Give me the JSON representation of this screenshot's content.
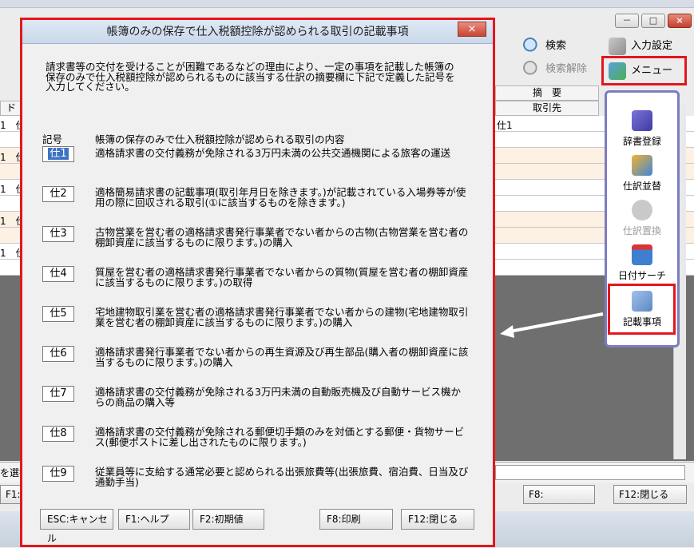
{
  "dialog": {
    "title": "帳簿のみの保存で仕入税額控除が認められる取引の記載事項",
    "close_label": "×",
    "intro": "請求書等の交付を受けることが困難であるなどの理由により、一定の事項を記載した帳簿の保存のみで仕入税額控除が認められるものに該当する仕訳の摘要欄に下記で定義した記号を入力してください。",
    "col_code": "記号",
    "col_content": "帳簿の保存のみで仕入税額控除が認められる取引の内容",
    "items": [
      {
        "code": "仕1",
        "text": "適格請求書の交付義務が免除される3万円未満の公共交通機関による旅客の運送"
      },
      {
        "code": "仕2",
        "text": "適格簡易請求書の記載事項(取引年月日を除きます。)が記載されている入場券等が使用の際に回収される取引(①に該当するものを除きます。)"
      },
      {
        "code": "仕3",
        "text": "古物営業を営む者の適格請求書発行事業者でない者からの古物(古物営業を営む者の棚卸資産に該当するものに限ります。)の購入"
      },
      {
        "code": "仕4",
        "text": "質屋を営む者の適格請求書発行事業者でない者からの質物(質屋を営む者の棚卸資産に該当するものに限ります。)の取得"
      },
      {
        "code": "仕5",
        "text": "宅地建物取引業を営む者の適格請求書発行事業者でない者からの建物(宅地建物取引業を営む者の棚卸資産に該当するものに限ります。)の購入"
      },
      {
        "code": "仕6",
        "text": "適格請求書発行事業者でない者からの再生資源及び再生部品(購入者の棚卸資産に該当するものに限ります。)の購入"
      },
      {
        "code": "仕7",
        "text": "適格請求書の交付義務が免除される3万円未満の自動販売機及び自動サービス機からの商品の購入等"
      },
      {
        "code": "仕8",
        "text": "適格請求書の交付義務が免除される郵便切手類のみを対価とする郵便・貨物サービス(郵便ポストに差し出されたものに限ります。)"
      },
      {
        "code": "仕9",
        "text": "従業員等に支給する通常必要と認められる出張旅費等(出張旅費、宿泊費、日当及び通勤手当)"
      }
    ],
    "buttons": {
      "esc": "ESC:キャンセル",
      "f1": "F1:ヘルプ",
      "f2": "F2:初期値",
      "f8": "F8:印刷",
      "f12": "F12:閉じる"
    }
  },
  "toolbar": {
    "search": "検索",
    "search_clear": "検索解除",
    "input_settings": "入力設定",
    "menu": "メニュー"
  },
  "window_controls": {
    "minimize": "－",
    "maximize": "□",
    "close": "×"
  },
  "grid": {
    "header_summary": "摘　要",
    "header_partner": "取引先",
    "left_header": "ド",
    "cell_summary_first": "仕1",
    "left_cells": [
      "1　仕",
      "1　仕",
      "1　仕",
      "1　仕",
      "1　仕"
    ]
  },
  "side_panel": {
    "items": [
      "辞書登録",
      "仕訳並替",
      "仕訳置換",
      "日付サーチ",
      "記載事項"
    ]
  },
  "bottom": {
    "left_text": "を選択",
    "f1": "F1:",
    "f8": "F8:",
    "f12": "F12:閉じる"
  }
}
